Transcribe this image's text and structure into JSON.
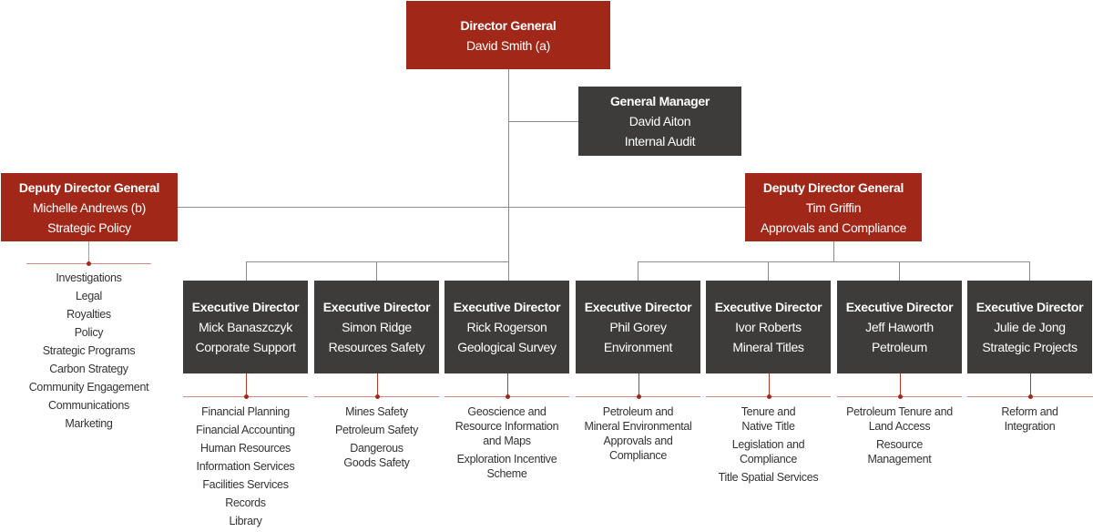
{
  "director_general": {
    "title": "Director General",
    "name": "David Smith (a)"
  },
  "general_manager": {
    "title": "General Manager",
    "name": "David Aiton",
    "unit": "Internal Audit"
  },
  "deputies": [
    {
      "title": "Deputy Director General",
      "name": "Michelle Andrews (b)",
      "unit": "Strategic Policy",
      "functions": [
        "Investigations",
        "Legal",
        "Royalties",
        "Policy",
        "Strategic Programs",
        "Carbon Strategy",
        "Community Engagement",
        "Communications",
        "Marketing"
      ]
    },
    {
      "title": "Deputy Director General",
      "name": "Tim Griffin",
      "unit": "Approvals and Compliance"
    }
  ],
  "executives": [
    {
      "title": "Executive Director",
      "name": "Mick Banaszczyk",
      "unit": "Corporate Support",
      "functions": [
        "Financial Planning",
        "Financial Accounting",
        "Human Resources",
        "Information Services",
        "Facilities Services",
        "Records",
        "Library"
      ]
    },
    {
      "title": "Executive Director",
      "name": "Simon Ridge",
      "unit": "Resources Safety",
      "functions": [
        "Mines Safety",
        "Petroleum Safety",
        "Dangerous\nGoods Safety"
      ]
    },
    {
      "title": "Executive Director",
      "name": "Rick Rogerson",
      "unit": "Geological Survey",
      "functions": [
        "Geoscience and\nResource Information\nand Maps",
        "Exploration Incentive\nScheme"
      ]
    },
    {
      "title": "Executive Director",
      "name": "Phil Gorey",
      "unit": "Environment",
      "functions": [
        "Petroleum and\nMineral Environmental\nApprovals and\nCompliance"
      ]
    },
    {
      "title": "Executive Director",
      "name": "Ivor Roberts",
      "unit": "Mineral Titles",
      "functions": [
        "Tenure and\nNative Title",
        "Legislation and\nCompliance",
        "Title Spatial Services"
      ]
    },
    {
      "title": "Executive Director",
      "name": "Jeff Haworth",
      "unit": "Petroleum",
      "functions": [
        "Petroleum Tenure and\nLand Access",
        "Resource\nManagement"
      ]
    },
    {
      "title": "Executive Director",
      "name": "Julie de Jong",
      "unit": "Strategic Projects",
      "functions": [
        "Reform and\nIntegration"
      ]
    }
  ],
  "colors": {
    "leadership_box": "#a12819",
    "executive_box": "#3d3c3a",
    "connector": "#8c8c8c",
    "function_rule": "#d98a80",
    "text_on_box": "#ffffff",
    "function_text": "#333333"
  }
}
